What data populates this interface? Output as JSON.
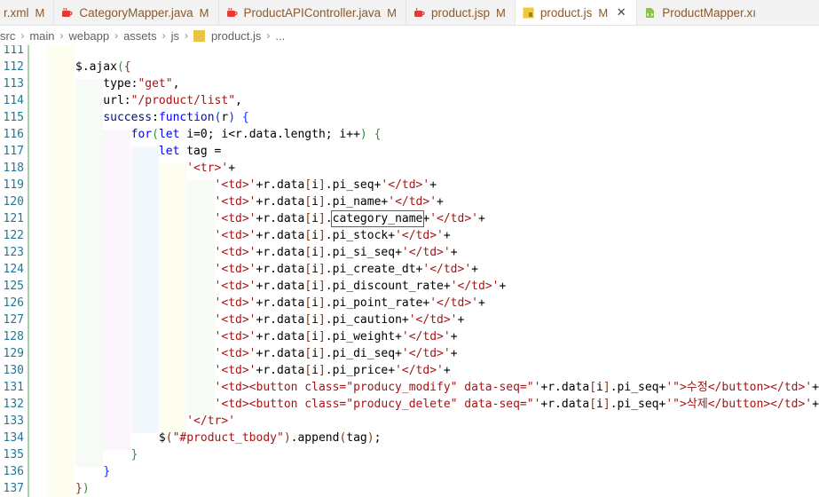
{
  "tabs": [
    {
      "label": "r.xml",
      "modified": "M",
      "icon": "xml-file-icon",
      "active": false
    },
    {
      "label": "CategoryMapper.java",
      "modified": "M",
      "icon": "java-file-icon",
      "active": false
    },
    {
      "label": "ProductAPIController.java",
      "modified": "M",
      "icon": "java-file-icon",
      "active": false
    },
    {
      "label": "product.jsp",
      "modified": "M",
      "icon": "jsp-file-icon",
      "active": false
    },
    {
      "label": "product.js",
      "modified": "M",
      "icon": "js-file-icon",
      "active": true,
      "close": "✕"
    },
    {
      "label": "ProductMapper.xı",
      "modified": "",
      "icon": "xml-file-icon",
      "active": false
    }
  ],
  "breadcrumb": [
    "src",
    "main",
    "webapp",
    "assets",
    "js",
    "product.js",
    "..."
  ],
  "highlight": {
    "line": "121",
    "text": "category_name"
  },
  "colors": {
    "keyword": "#0000ff",
    "string": "#a31515",
    "property": "#001080",
    "bracket1": "#319331",
    "bracket2": "#7b3814",
    "bracket3": "#0431fa",
    "line_number": "#237893",
    "modified_gutter": "#a6d4a9",
    "highlight_box": "#d32f2f"
  },
  "lines": [
    {
      "n": "111",
      "tokens": []
    },
    {
      "n": "112",
      "tokens": [
        [
          "def",
          "$.ajax"
        ],
        [
          "b1",
          "("
        ],
        [
          "b2",
          "{"
        ]
      ]
    },
    {
      "n": "113",
      "tokens": [
        [
          "def",
          "    type:"
        ],
        [
          "str",
          "\"get\""
        ],
        [
          "def",
          ","
        ]
      ]
    },
    {
      "n": "114",
      "tokens": [
        [
          "def",
          "    url:"
        ],
        [
          "str",
          "\"/product/list\""
        ],
        [
          "def",
          ","
        ]
      ]
    },
    {
      "n": "115",
      "tokens": [
        [
          "def",
          "    "
        ],
        [
          "prop",
          "success"
        ],
        [
          "def",
          ":"
        ],
        [
          "kw",
          "function"
        ],
        [
          "b3",
          "("
        ],
        [
          "def",
          "r"
        ],
        [
          "b3",
          ")"
        ],
        [
          "def",
          " "
        ],
        [
          "b3",
          "{"
        ]
      ]
    },
    {
      "n": "116",
      "tokens": [
        [
          "def",
          "        "
        ],
        [
          "kw",
          "for"
        ],
        [
          "b1",
          "("
        ],
        [
          "kw",
          "let"
        ],
        [
          "def",
          " i=0; i<r.data.length; i++"
        ],
        [
          "b1",
          ")"
        ],
        [
          "def",
          " "
        ],
        [
          "b1",
          "{"
        ]
      ]
    },
    {
      "n": "117",
      "tokens": [
        [
          "def",
          "            "
        ],
        [
          "kw",
          "let"
        ],
        [
          "def",
          " tag ="
        ]
      ]
    },
    {
      "n": "118",
      "tokens": [
        [
          "def",
          "                "
        ],
        [
          "str",
          "'<tr>'"
        ],
        [
          "def",
          "+"
        ]
      ]
    },
    {
      "n": "119",
      "tokens": [
        [
          "def",
          "                    "
        ],
        [
          "str",
          "'<td>'"
        ],
        [
          "def",
          "+r.data"
        ],
        [
          "b2",
          "["
        ],
        [
          "def",
          "i"
        ],
        [
          "b2",
          "]"
        ],
        [
          "def",
          ".pi_seq+"
        ],
        [
          "str",
          "'</td>'"
        ],
        [
          "def",
          "+"
        ]
      ]
    },
    {
      "n": "120",
      "tokens": [
        [
          "def",
          "                    "
        ],
        [
          "str",
          "'<td>'"
        ],
        [
          "def",
          "+r.data"
        ],
        [
          "b2",
          "["
        ],
        [
          "def",
          "i"
        ],
        [
          "b2",
          "]"
        ],
        [
          "def",
          ".pi_name+"
        ],
        [
          "str",
          "'</td>'"
        ],
        [
          "def",
          "+"
        ]
      ]
    },
    {
      "n": "121",
      "tokens": [
        [
          "def",
          "                    "
        ],
        [
          "str",
          "'<td>'"
        ],
        [
          "def",
          "+r.data"
        ],
        [
          "b2",
          "["
        ],
        [
          "def",
          "i"
        ],
        [
          "b2",
          "]"
        ],
        [
          "def",
          "."
        ],
        [
          "hl",
          "category_name"
        ],
        [
          "def",
          "+"
        ],
        [
          "str",
          "'</td>'"
        ],
        [
          "def",
          "+"
        ]
      ]
    },
    {
      "n": "122",
      "tokens": [
        [
          "def",
          "                    "
        ],
        [
          "str",
          "'<td>'"
        ],
        [
          "def",
          "+r.data"
        ],
        [
          "b2",
          "["
        ],
        [
          "def",
          "i"
        ],
        [
          "b2",
          "]"
        ],
        [
          "def",
          ".pi_stock+"
        ],
        [
          "str",
          "'</td>'"
        ],
        [
          "def",
          "+"
        ]
      ]
    },
    {
      "n": "123",
      "tokens": [
        [
          "def",
          "                    "
        ],
        [
          "str",
          "'<td>'"
        ],
        [
          "def",
          "+r.data"
        ],
        [
          "b2",
          "["
        ],
        [
          "def",
          "i"
        ],
        [
          "b2",
          "]"
        ],
        [
          "def",
          ".pi_si_seq+"
        ],
        [
          "str",
          "'</td>'"
        ],
        [
          "def",
          "+"
        ]
      ]
    },
    {
      "n": "124",
      "tokens": [
        [
          "def",
          "                    "
        ],
        [
          "str",
          "'<td>'"
        ],
        [
          "def",
          "+r.data"
        ],
        [
          "b2",
          "["
        ],
        [
          "def",
          "i"
        ],
        [
          "b2",
          "]"
        ],
        [
          "def",
          ".pi_create_dt+"
        ],
        [
          "str",
          "'</td>'"
        ],
        [
          "def",
          "+"
        ]
      ]
    },
    {
      "n": "125",
      "tokens": [
        [
          "def",
          "                    "
        ],
        [
          "str",
          "'<td>'"
        ],
        [
          "def",
          "+r.data"
        ],
        [
          "b2",
          "["
        ],
        [
          "def",
          "i"
        ],
        [
          "b2",
          "]"
        ],
        [
          "def",
          ".pi_discount_rate+"
        ],
        [
          "str",
          "'</td>'"
        ],
        [
          "def",
          "+"
        ]
      ]
    },
    {
      "n": "126",
      "tokens": [
        [
          "def",
          "                    "
        ],
        [
          "str",
          "'<td>'"
        ],
        [
          "def",
          "+r.data"
        ],
        [
          "b2",
          "["
        ],
        [
          "def",
          "i"
        ],
        [
          "b2",
          "]"
        ],
        [
          "def",
          ".pi_point_rate+"
        ],
        [
          "str",
          "'</td>'"
        ],
        [
          "def",
          "+"
        ]
      ]
    },
    {
      "n": "127",
      "tokens": [
        [
          "def",
          "                    "
        ],
        [
          "str",
          "'<td>'"
        ],
        [
          "def",
          "+r.data"
        ],
        [
          "b2",
          "["
        ],
        [
          "def",
          "i"
        ],
        [
          "b2",
          "]"
        ],
        [
          "def",
          ".pi_caution+"
        ],
        [
          "str",
          "'</td>'"
        ],
        [
          "def",
          "+"
        ]
      ]
    },
    {
      "n": "128",
      "tokens": [
        [
          "def",
          "                    "
        ],
        [
          "str",
          "'<td>'"
        ],
        [
          "def",
          "+r.data"
        ],
        [
          "b2",
          "["
        ],
        [
          "def",
          "i"
        ],
        [
          "b2",
          "]"
        ],
        [
          "def",
          ".pi_weight+"
        ],
        [
          "str",
          "'</td>'"
        ],
        [
          "def",
          "+"
        ]
      ]
    },
    {
      "n": "129",
      "tokens": [
        [
          "def",
          "                    "
        ],
        [
          "str",
          "'<td>'"
        ],
        [
          "def",
          "+r.data"
        ],
        [
          "b2",
          "["
        ],
        [
          "def",
          "i"
        ],
        [
          "b2",
          "]"
        ],
        [
          "def",
          ".pi_di_seq+"
        ],
        [
          "str",
          "'</td>'"
        ],
        [
          "def",
          "+"
        ]
      ]
    },
    {
      "n": "130",
      "tokens": [
        [
          "def",
          "                    "
        ],
        [
          "str",
          "'<td>'"
        ],
        [
          "def",
          "+r.data"
        ],
        [
          "b2",
          "["
        ],
        [
          "def",
          "i"
        ],
        [
          "b2",
          "]"
        ],
        [
          "def",
          ".pi_price+"
        ],
        [
          "str",
          "'</td>'"
        ],
        [
          "def",
          "+"
        ]
      ]
    },
    {
      "n": "131",
      "tokens": [
        [
          "def",
          "                    "
        ],
        [
          "str",
          "'<td><button class=\"producy_modify\" data-seq=\"'"
        ],
        [
          "def",
          "+r.data"
        ],
        [
          "b2",
          "["
        ],
        [
          "def",
          "i"
        ],
        [
          "b2",
          "]"
        ],
        [
          "def",
          ".pi_seq+"
        ],
        [
          "str",
          "'\">수정</button></td>'"
        ],
        [
          "def",
          "+"
        ]
      ]
    },
    {
      "n": "132",
      "tokens": [
        [
          "def",
          "                    "
        ],
        [
          "str",
          "'<td><button class=\"producy_delete\" data-seq=\"'"
        ],
        [
          "def",
          "+r.data"
        ],
        [
          "b2",
          "["
        ],
        [
          "def",
          "i"
        ],
        [
          "b2",
          "]"
        ],
        [
          "def",
          ".pi_seq+"
        ],
        [
          "str",
          "'\">삭제</button></td>'"
        ],
        [
          "def",
          "+"
        ]
      ]
    },
    {
      "n": "133",
      "tokens": [
        [
          "def",
          "                "
        ],
        [
          "str",
          "'</tr>'"
        ]
      ]
    },
    {
      "n": "134",
      "tokens": [
        [
          "def",
          "            $"
        ],
        [
          "b2",
          "("
        ],
        [
          "str",
          "\"#product_tbody\""
        ],
        [
          "b2",
          ")"
        ],
        [
          "def",
          ".append"
        ],
        [
          "b2",
          "("
        ],
        [
          "def",
          "tag"
        ],
        [
          "b2",
          ")"
        ],
        [
          "def",
          ";"
        ]
      ]
    },
    {
      "n": "135",
      "tokens": [
        [
          "def",
          "        "
        ],
        [
          "b1",
          "}"
        ]
      ]
    },
    {
      "n": "136",
      "tokens": [
        [
          "def",
          "    "
        ],
        [
          "b3",
          "}"
        ]
      ]
    },
    {
      "n": "137",
      "tokens": [
        [
          "b2",
          "}"
        ],
        [
          "b1",
          ")"
        ]
      ]
    }
  ]
}
